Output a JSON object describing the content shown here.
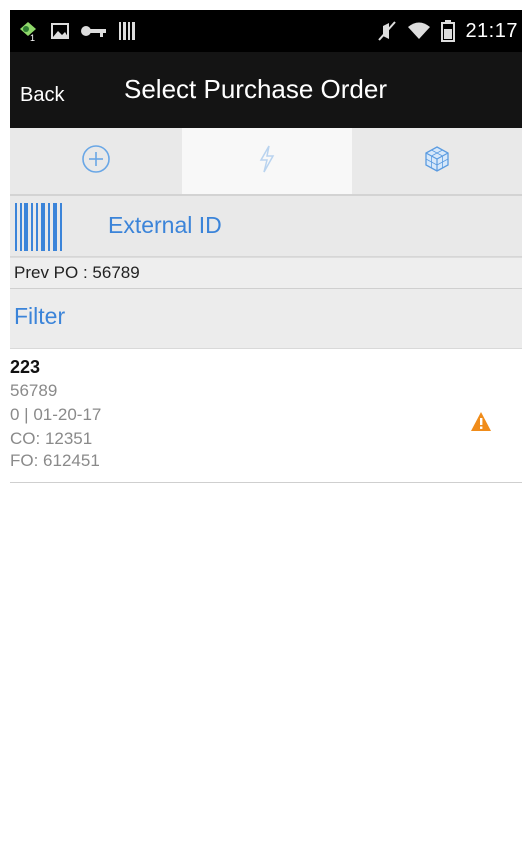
{
  "status_bar": {
    "time": "21:17",
    "icons_left": [
      "app-notification-icon",
      "image-icon",
      "key-icon",
      "barcode-small-icon"
    ],
    "icons_right": [
      "mute-icon",
      "wifi-icon",
      "battery-icon"
    ]
  },
  "action_bar": {
    "back_label": "Back",
    "title": "Select Purchase Order"
  },
  "tabs": [
    {
      "icon": "add-circle-icon"
    },
    {
      "icon": "lightning-icon"
    },
    {
      "icon": "cube-icon"
    }
  ],
  "scan": {
    "icon": "barcode-icon",
    "label": "External ID"
  },
  "prev_po": {
    "text": "Prev PO : 56789"
  },
  "filter": {
    "label": "Filter"
  },
  "orders": [
    {
      "id": "223",
      "number": "56789",
      "status_date": "0  |  01-20-17",
      "co": "CO: 12351",
      "fo": "FO: 612451",
      "warning": true,
      "warning_color": "#f08c1a"
    }
  ],
  "colors": {
    "accent": "#3b84d9",
    "action_bar": "#141414",
    "status_bar": "#000000",
    "tab_icon": "#6aa7e6"
  }
}
